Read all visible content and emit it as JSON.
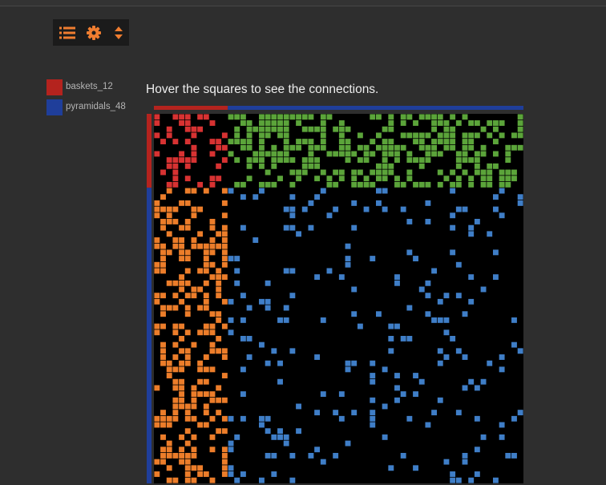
{
  "toolbar": {
    "buttons": [
      {
        "icon": "list-icon",
        "label": "list"
      },
      {
        "icon": "gear-icon",
        "label": "settings"
      },
      {
        "icon": "sort-icon",
        "label": "sort"
      }
    ],
    "icon_color": "#ef7d30"
  },
  "legend": {
    "items": [
      {
        "label": "baskets_12",
        "color": "#b4231e"
      },
      {
        "label": "pyramidals_48",
        "color": "#1f3e9a"
      }
    ]
  },
  "hint": "Hover the squares to see the connections.",
  "colors": {
    "background": "#2e2e2e",
    "matrix_background": "#000000",
    "baskets_to_baskets": "#d73232",
    "baskets_to_pyramidals": "#ec7d2a",
    "pyramidals_to_baskets": "#5ba43a",
    "pyramidals_to_pyramidals": "#3f7ec7"
  },
  "chart_data": {
    "type": "heatmap",
    "description_of_values": "connection matrix between populations",
    "populations": [
      {
        "name": "baskets_12",
        "size": 12,
        "color": "#b4231e"
      },
      {
        "name": "pyramidals_48",
        "size": 48,
        "color": "#1f3e9a"
      }
    ],
    "blocks": [
      {
        "pre": "baskets_12",
        "post": "baskets_12",
        "color": "#d73232",
        "density": 0.34
      },
      {
        "pre": "pyramidals_48",
        "post": "baskets_12",
        "color": "#5ba43a",
        "density": 0.5
      },
      {
        "pre": "baskets_12",
        "post": "pyramidals_48",
        "color": "#ec7d2a",
        "density": 0.4
      },
      {
        "pre": "pyramidals_48",
        "post": "pyramidals_48",
        "color": "#3f7ec7",
        "density": 0.1
      }
    ]
  }
}
